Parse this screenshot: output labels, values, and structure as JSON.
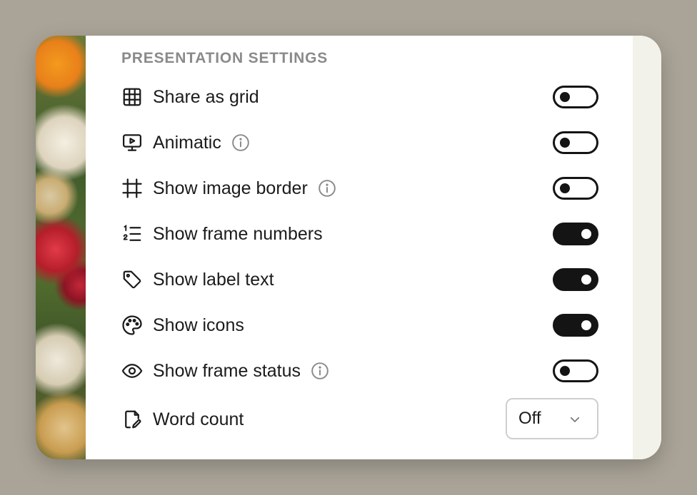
{
  "section_title": "PRESENTATION SETTINGS",
  "settings": [
    {
      "label": "Share as grid",
      "icon": "grid-icon",
      "info": false,
      "control": "toggle",
      "on": false
    },
    {
      "label": "Animatic",
      "icon": "monitor-play-icon",
      "info": true,
      "control": "toggle",
      "on": false
    },
    {
      "label": "Show image border",
      "icon": "crop-frame-icon",
      "info": true,
      "control": "toggle",
      "on": false
    },
    {
      "label": "Show frame numbers",
      "icon": "numbered-list-icon",
      "info": false,
      "control": "toggle",
      "on": true
    },
    {
      "label": "Show label text",
      "icon": "tag-icon",
      "info": false,
      "control": "toggle",
      "on": true
    },
    {
      "label": "Show icons",
      "icon": "palette-icon",
      "info": false,
      "control": "toggle",
      "on": true
    },
    {
      "label": "Show frame status",
      "icon": "eye-icon",
      "info": true,
      "control": "toggle",
      "on": false
    },
    {
      "label": "Word count",
      "icon": "document-edit-icon",
      "info": false,
      "control": "select",
      "value": "Off"
    }
  ],
  "colors": {
    "toggle_on": "#141414",
    "text": "#1b1b1b",
    "section_title": "#8a8a8a",
    "backdrop": "#aaa498"
  }
}
